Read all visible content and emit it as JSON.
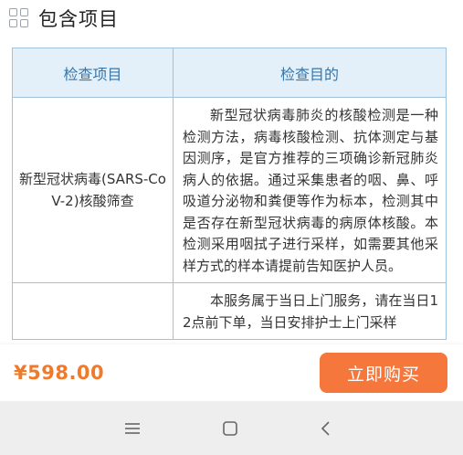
{
  "section": {
    "title": "包含项目",
    "icon": "grid-icon"
  },
  "table": {
    "headers": [
      "检查项目",
      "检查目的"
    ],
    "rows": [
      {
        "name": "新型冠状病毒(SARS-CoV-2)核酸筛查",
        "purpose": "新型冠状病毒肺炎的核酸检测是一种检测方法，病毒核酸检测、抗体测定与基因测序，是官方推荐的三项确诊新冠肺炎病人的依据。通过采集患者的咽、鼻、呼吸道分泌物和粪便等作为标本，检测其中是否存在新型冠状病毒的病原体核酸。本检测采用咽拭子进行采样，如需要其他采样方式的样本请提前告知医护人员。"
      },
      {
        "name": "",
        "purpose": "本服务属于当日上门服务，请在当日12点前下单，当日安排护士上门采样"
      }
    ]
  },
  "footer": {
    "price": "¥598.00",
    "buy_label": "立即购买"
  },
  "navbar": {
    "icons": [
      "menu-icon",
      "home-icon",
      "back-icon"
    ]
  },
  "colors": {
    "accent": "#f5773c",
    "price": "#f07a2a",
    "header_bg": "#e3f0fa",
    "header_text": "#3576a9",
    "border": "#9fc3df"
  }
}
